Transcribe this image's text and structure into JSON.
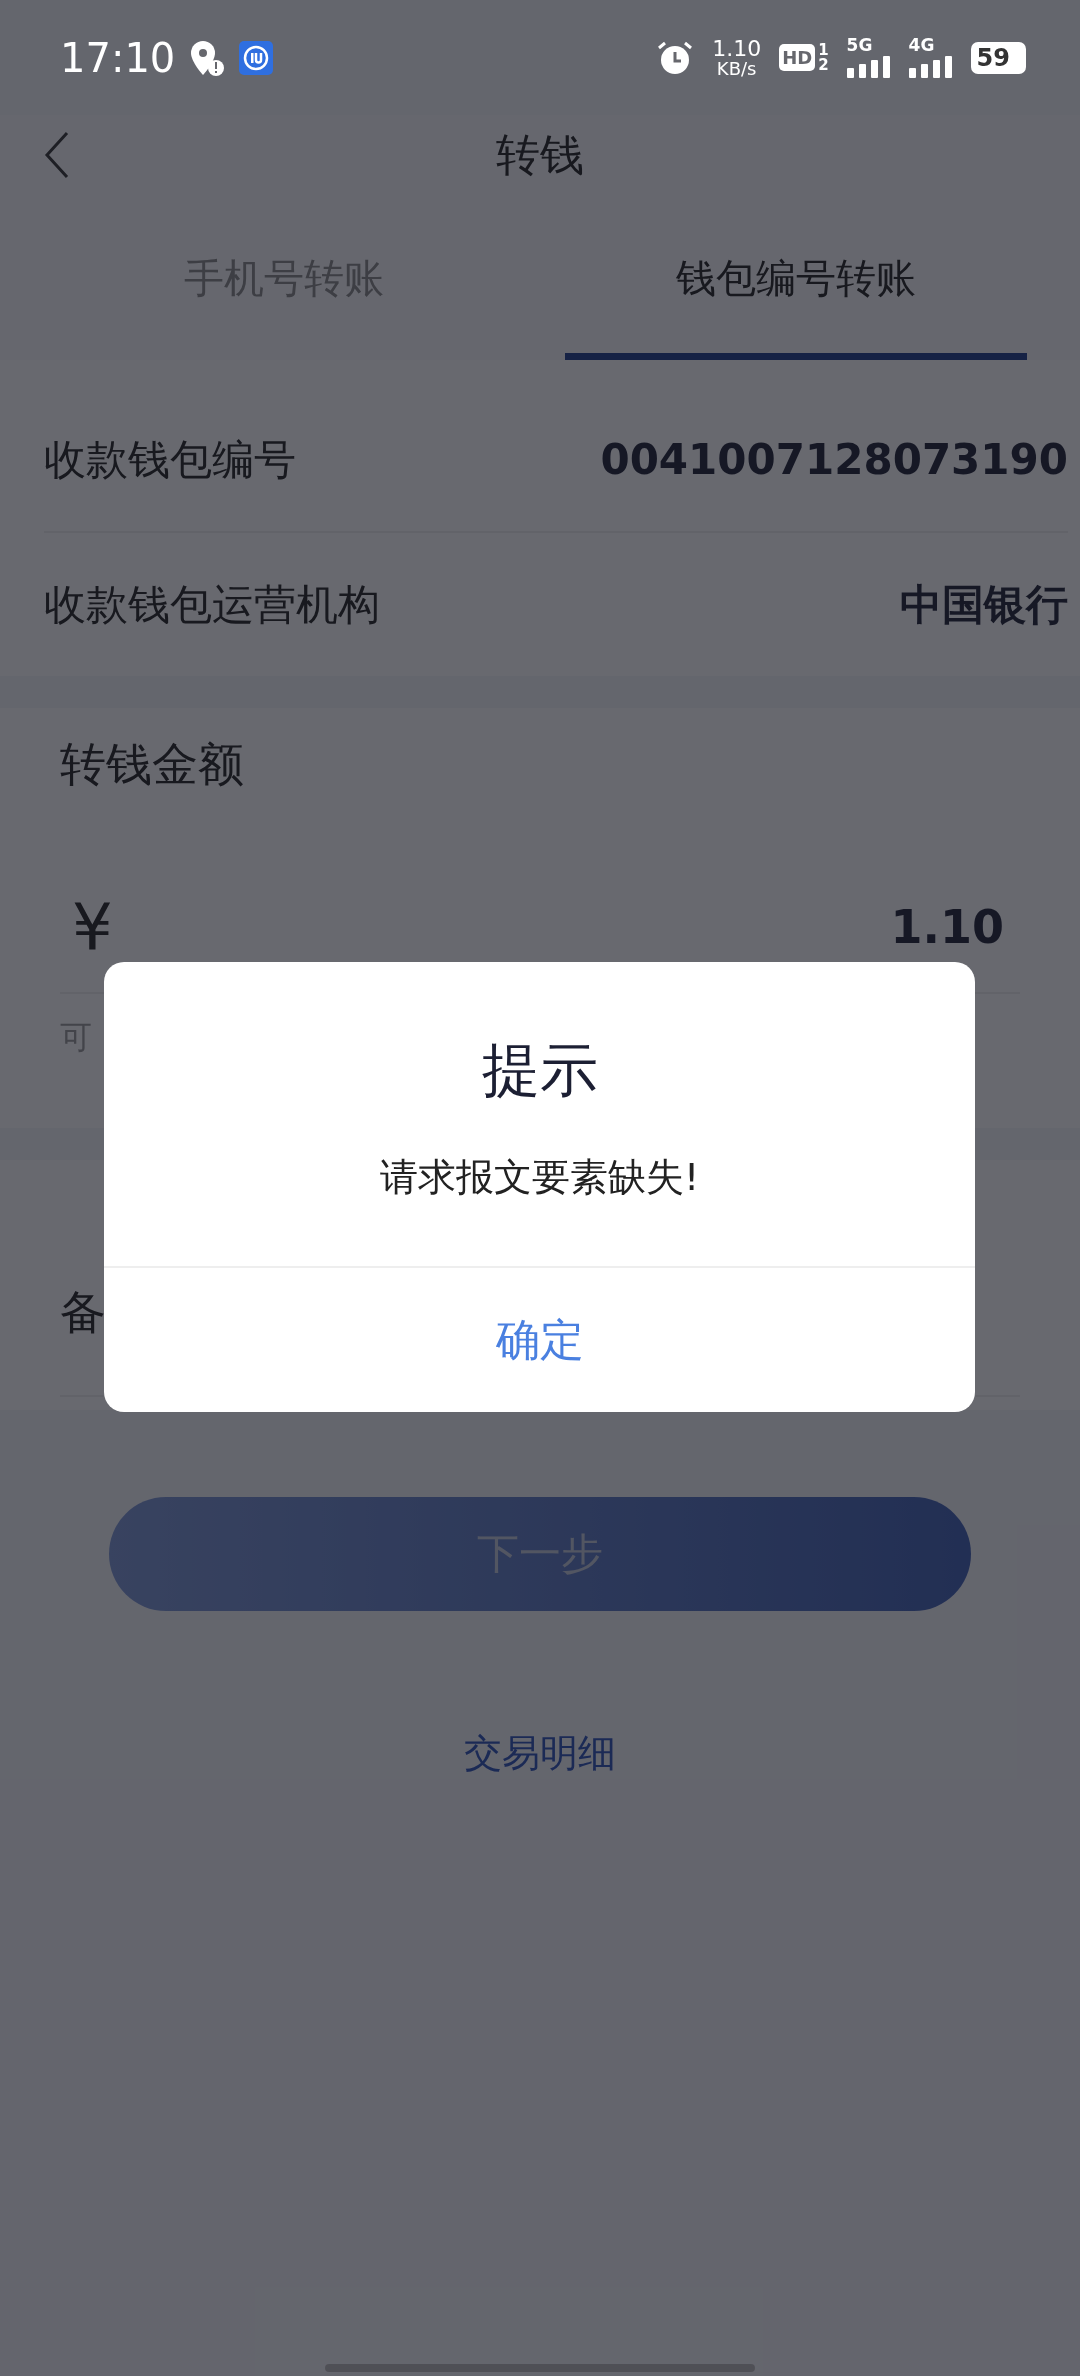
{
  "status_bar": {
    "time": "17:10",
    "speed_value": "1.10",
    "speed_unit": "KB/s",
    "hd": "HD",
    "sim_1": "1",
    "sim_2": "2",
    "network_1": "5G",
    "network_2": "4G",
    "battery": "59"
  },
  "header": {
    "title": "转钱"
  },
  "tabs": [
    {
      "label": "手机号转账",
      "selected": false
    },
    {
      "label": "钱包编号转账",
      "selected": true
    }
  ],
  "recipient": [
    {
      "label": "收款钱包编号",
      "value": "0041007128073190"
    },
    {
      "label": "收款钱包运营机构",
      "value": "中国银行"
    }
  ],
  "amount": {
    "title": "转钱金额",
    "currency": "¥",
    "value": "1.10",
    "hint": "可"
  },
  "remark": {
    "label": "备"
  },
  "next_button": {
    "label": "下一步",
    "disabled": true
  },
  "details_link": "交易明细",
  "dialog": {
    "title": "提示",
    "message": "请求报文要素缺失!",
    "confirm": "确定"
  }
}
